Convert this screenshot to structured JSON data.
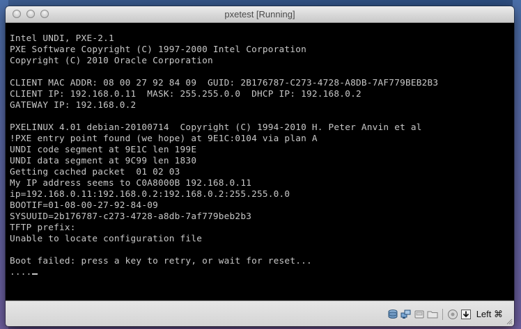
{
  "window": {
    "title": "pxetest [Running]"
  },
  "console": {
    "lines": [
      "Intel UNDI, PXE-2.1",
      "PXE Software Copyright (C) 1997-2000 Intel Corporation",
      "Copyright (C) 2010 Oracle Corporation",
      "",
      "CLIENT MAC ADDR: 08 00 27 92 84 09  GUID: 2B176787-C273-4728-A8DB-7AF779BEB2B3",
      "CLIENT IP: 192.168.0.11  MASK: 255.255.0.0  DHCP IP: 192.168.0.2",
      "GATEWAY IP: 192.168.0.2",
      "",
      "PXELINUX 4.01 debian-20100714  Copyright (C) 1994-2010 H. Peter Anvin et al",
      "!PXE entry point found (we hope) at 9E1C:0104 via plan A",
      "UNDI code segment at 9E1C len 199E",
      "UNDI data segment at 9C99 len 1830",
      "Getting cached packet  01 02 03",
      "My IP address seems to C0A8000B 192.168.0.11",
      "ip=192.168.0.11:192.168.0.2:192.168.0.2:255.255.0.0",
      "BOOTIF=01-08-00-27-92-84-09",
      "SYSUUID=2b176787-c273-4728-a8db-7af779beb2b3",
      "TFTP prefix:",
      "Unable to locate configuration file",
      "",
      "Boot failed: press a key to retry, or wait for reset...",
      "...."
    ]
  },
  "statusbar": {
    "icons": [
      "hard-disk-icon",
      "network-icon",
      "usb-icon",
      "shared-folders-icon",
      "virtualization-icon",
      "keyboard-capture-icon"
    ],
    "host_key_label": "Left ⌘"
  },
  "colors": {
    "console_text": "#c8c8c8",
    "console_bg": "#000000",
    "statusbar_bg": "#d9d9d9"
  }
}
